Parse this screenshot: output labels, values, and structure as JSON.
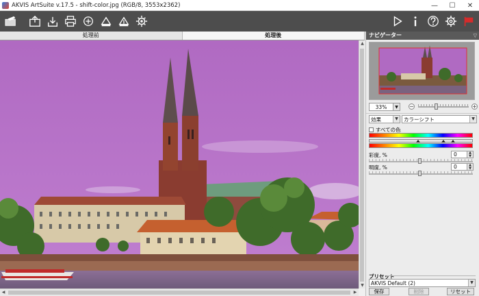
{
  "window": {
    "title": "AKVIS ArtSuite v.17.5 - shift-color.jpg (RGB/8, 3553x2362)",
    "minimize": "—",
    "maximize": "☐",
    "close": "✕"
  },
  "toolbar": {
    "left_icons": [
      "open-brush-icon",
      "open-file-icon",
      "save-icon",
      "print-icon",
      "share-icon",
      "batch-icon",
      "export-icon",
      "settings-cog-icon"
    ],
    "right_icons": [
      "run-icon",
      "info-icon",
      "help-icon",
      "preferences-icon",
      "flag-icon"
    ],
    "accent_color": "#d62b2b"
  },
  "tabs": [
    {
      "label": "処理前",
      "active": false
    },
    {
      "label": "処理後",
      "active": true
    }
  ],
  "navigator": {
    "title": "ナビゲーター",
    "zoom": "33%"
  },
  "effect": {
    "group_label": "効果",
    "effect_value": "カラーシフト"
  },
  "color_shift": {
    "all_colors_label": "すべての色",
    "saturation_label": "彩度, %",
    "saturation_value": "0",
    "brightness_label": "明度, %",
    "brightness_value": "0"
  },
  "presets": {
    "title": "プリセット",
    "selected": "AKVIS Default (2)",
    "save_label": "保存",
    "delete_label": "削除",
    "reset_label": "リセット"
  },
  "colors": {
    "sky": "#b46fc3",
    "toolbar_bg": "#4d4d4d",
    "panel_header": "#5a5a5a"
  }
}
